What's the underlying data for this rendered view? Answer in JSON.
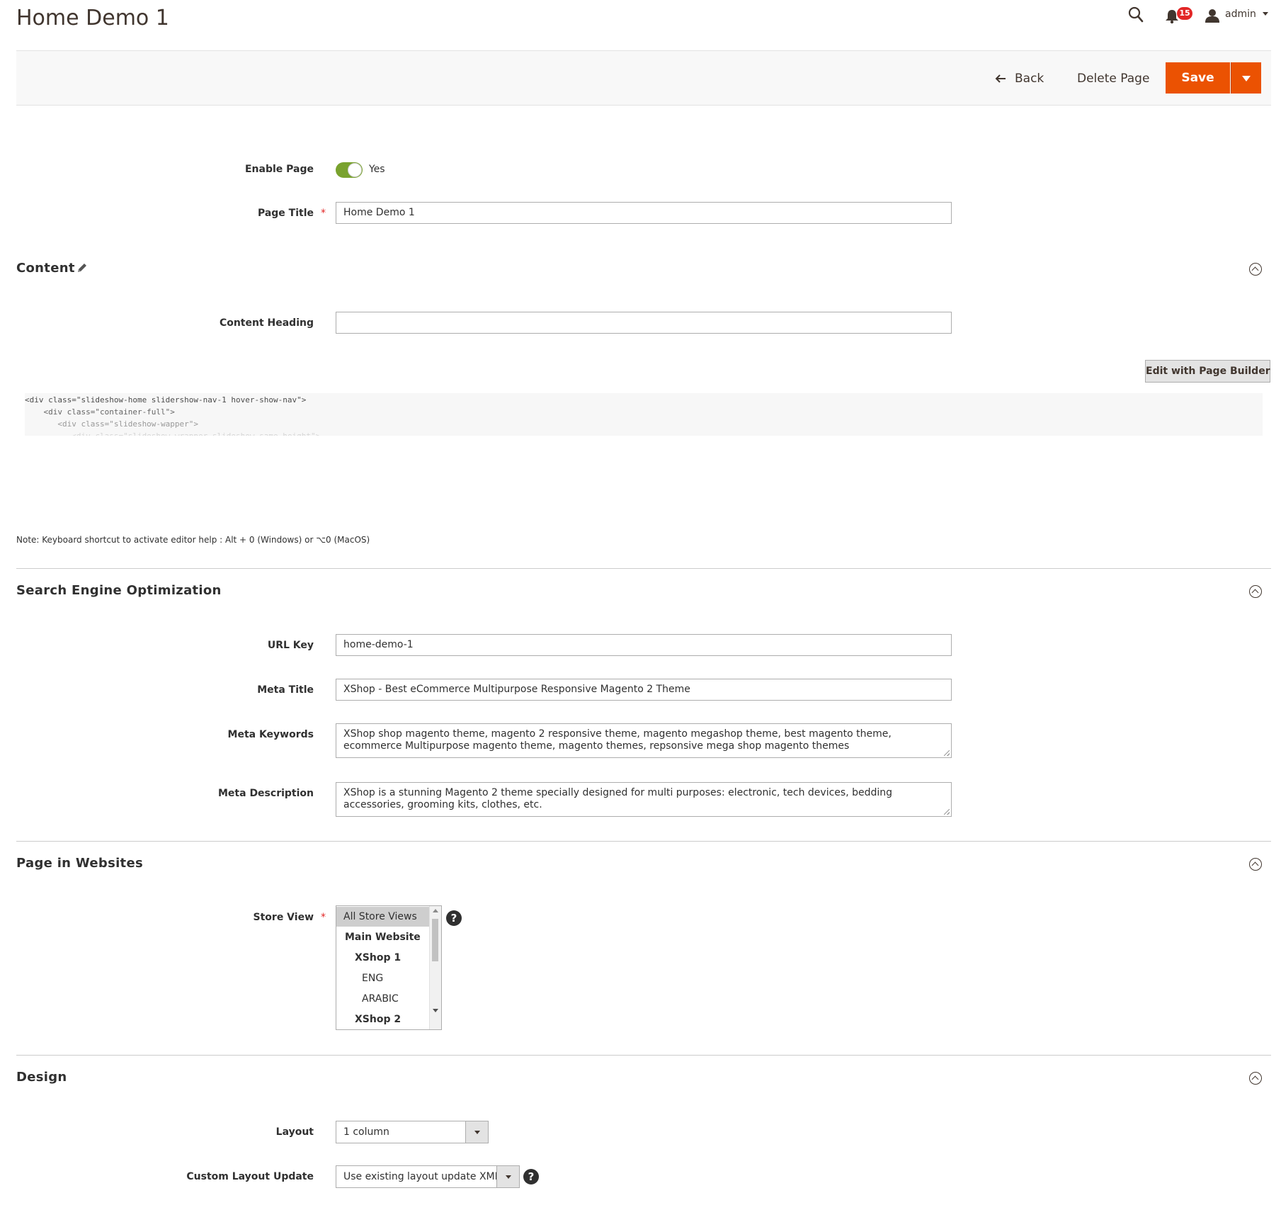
{
  "header": {
    "page_title": "Home Demo 1",
    "notifications_count": "15",
    "user_name": "admin"
  },
  "actions": {
    "back_label": "Back",
    "delete_label": "Delete Page",
    "save_label": "Save"
  },
  "general": {
    "enable_page_label": "Enable Page",
    "enable_page_state": "Yes",
    "enable_page_on": true,
    "page_title_label": "Page Title",
    "page_title_value": "Home Demo 1",
    "required_mark": "*"
  },
  "content": {
    "section_title": "Content",
    "heading_label": "Content Heading",
    "heading_value": "",
    "page_builder_button": "Edit with Page Builder",
    "code_lines": [
      "<div class=\"slideshow-home slidershow-nav-1 hover-show-nav\">",
      "    <div class=\"container-full\">",
      "       <div class=\"slideshow-wapper\">",
      "          <div class=\"slideshow-wrapper slideshow-same-height\">"
    ],
    "editor_note": "Note: Keyboard shortcut to activate editor help : Alt + 0 (Windows) or ⌥0 (MacOS)"
  },
  "seo": {
    "section_title": "Search Engine Optimization",
    "url_key_label": "URL Key",
    "url_key_value": "home-demo-1",
    "meta_title_label": "Meta Title",
    "meta_title_value": "XShop - Best eCommerce Multipurpose Responsive Magento 2 Theme",
    "meta_keywords_label": "Meta Keywords",
    "meta_keywords_value": "XShop shop magento theme, magento 2 responsive theme, magento megashop theme, best magento theme, ecommerce Multipurpose magento theme,  magento themes, repsonsive mega shop magento themes",
    "meta_description_label": "Meta Description",
    "meta_description_value": "XShop is a stunning Magento 2 theme specially designed for multi purposes: electronic, tech devices, bedding accessories, grooming kits, clothes, etc."
  },
  "websites": {
    "section_title": "Page in Websites",
    "store_view_label": "Store View",
    "store_view_options": [
      {
        "label": "All Store Views",
        "selected": true,
        "bold": false,
        "indent": 0
      },
      {
        "label": "Main Website",
        "selected": false,
        "bold": true,
        "indent": 1
      },
      {
        "label": "XShop 1",
        "selected": false,
        "bold": true,
        "indent": 2
      },
      {
        "label": "ENG",
        "selected": false,
        "bold": false,
        "indent": 3
      },
      {
        "label": "ARABIC",
        "selected": false,
        "bold": false,
        "indent": 3
      },
      {
        "label": "XShop 2",
        "selected": false,
        "bold": true,
        "indent": 2
      }
    ],
    "help_glyph": "?"
  },
  "design": {
    "section_title": "Design",
    "layout_label": "Layout",
    "layout_value": "1 column",
    "custom_layout_label": "Custom Layout Update",
    "custom_layout_value": "Use existing layout update XML",
    "help_glyph": "?"
  },
  "icons": {
    "search": "search-icon",
    "notifications": "bell-icon",
    "user": "user-icon",
    "back": "arrow-left-icon",
    "edit": "pencil-icon",
    "collapse": "chevron-up-icon",
    "help": "question-icon"
  },
  "colors": {
    "primary_button": "#eb5202",
    "toggle_on": "#79a22e",
    "badge": "#e22626",
    "required": "#e22626"
  }
}
